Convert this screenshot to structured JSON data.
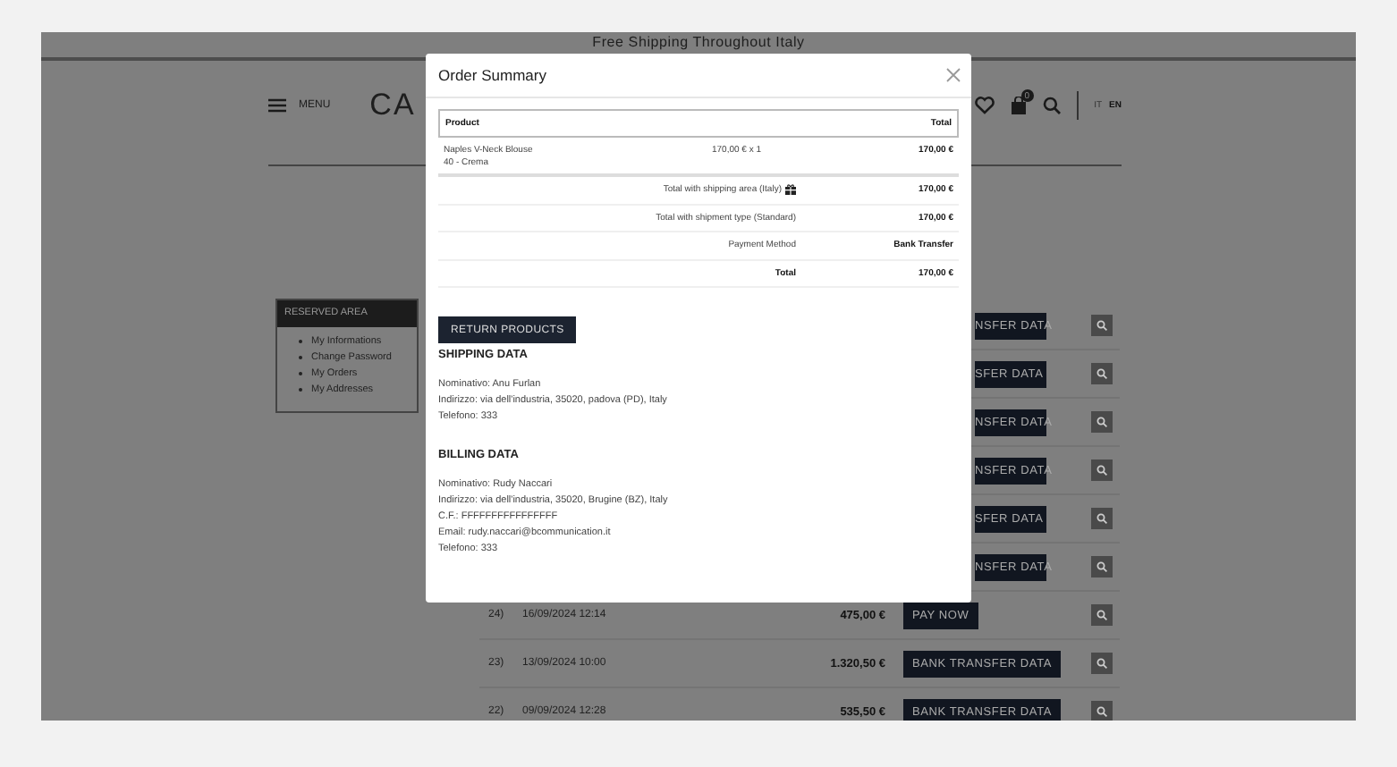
{
  "promo_bar": {
    "text": "Free Shipping Throughout Italy"
  },
  "header": {
    "menu_label": "MENU",
    "logo": "CA",
    "languages": [
      {
        "label": "IT",
        "selected": false
      },
      {
        "label": "EN",
        "selected": true
      }
    ],
    "cart_count": "0"
  },
  "sidebar": {
    "title": "RESERVED AREA",
    "items": [
      "My Informations",
      "Change Password",
      "My Orders",
      "My Addresses"
    ]
  },
  "orders": [
    {
      "kind": "covered",
      "action": "NSFER DATA"
    },
    {
      "kind": "covered",
      "action": "SFER DATA"
    },
    {
      "kind": "covered",
      "action": "NSFER DATA"
    },
    {
      "kind": "covered",
      "action": "NSFER DATA"
    },
    {
      "kind": "covered",
      "action": "SFER DATA"
    },
    {
      "kind": "covered",
      "action": "NSFER DATA"
    },
    {
      "kind": "full",
      "number": "24)",
      "date": "16/09/2024 12:14",
      "amount": "475,00 €",
      "action": "PAY NOW"
    },
    {
      "kind": "full",
      "number": "23)",
      "date": "13/09/2024 10:00",
      "amount": "1.320,50 €",
      "action": "BANK TRANSFER DATA"
    },
    {
      "kind": "full",
      "number": "22)",
      "date": "09/09/2024 12:28",
      "amount": "535,50 €",
      "action": "BANK TRANSFER DATA"
    }
  ],
  "modal": {
    "title": "Order Summary",
    "table": {
      "columns": [
        "Product",
        "Total"
      ],
      "items": [
        {
          "name": "Naples V-Neck Blouse",
          "variant": "40 - Crema",
          "price": "170,00 € x 1",
          "total": "170,00 €"
        }
      ],
      "summary": [
        {
          "label": "Total with shipping area (Italy)",
          "gift_icon": true,
          "value": "170,00 €",
          "bold_label": false
        },
        {
          "label": "Total with shipment type (Standard)",
          "gift_icon": false,
          "value": "170,00 €",
          "bold_label": false
        },
        {
          "label": "Payment Method",
          "gift_icon": false,
          "value": "Bank Transfer",
          "bold_label": false
        },
        {
          "label": "Total",
          "gift_icon": false,
          "value": "170,00 €",
          "bold_label": true
        }
      ]
    },
    "return_button": "RETURN PRODUCTS",
    "sections": [
      {
        "title": "SHIPPING DATA",
        "lines": [
          "Nominativo: Anu Furlan",
          "Indirizzo: via dell'industria, 35020, padova (PD), Italy",
          "Telefono: 333"
        ]
      },
      {
        "title": "BILLING DATA",
        "lines": [
          "Nominativo: Rudy Naccari",
          "Indirizzo: via dell'industria, 35020, Brugine (BZ), Italy",
          "C.F.: FFFFFFFFFFFFFFFF",
          "Email: rudy.naccari@bcommunication.it",
          "Telefono: 333"
        ]
      }
    ]
  }
}
